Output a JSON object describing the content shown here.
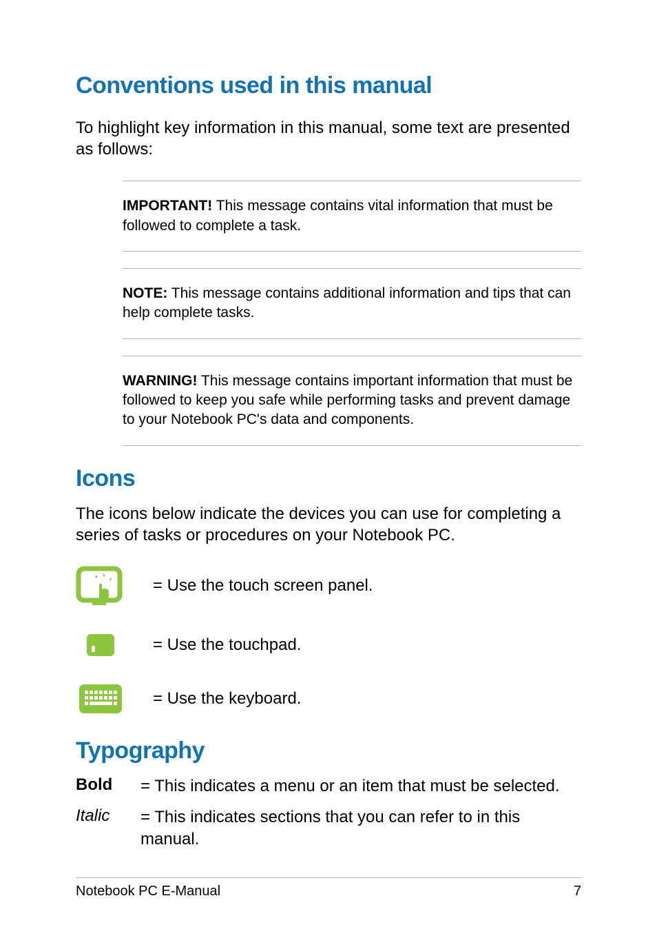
{
  "headings": {
    "conventions": "Conventions used in this manual",
    "icons": "Icons",
    "typography": "Typography"
  },
  "body": {
    "conventions_intro": "To highlight key information in this manual, some text are presented as follows:",
    "icons_intro": "The icons below indicate the devices you can use for completing a series of tasks or procedures on your Notebook PC."
  },
  "callouts": {
    "important": {
      "label": "IMPORTANT!",
      "text": " This message contains vital information that must be followed to complete a task."
    },
    "note": {
      "label": "NOTE:",
      "text": " This message contains additional information and tips that can help complete tasks."
    },
    "warning": {
      "label": "WARNING!",
      "text": " This message contains important information that must be followed to keep you safe while performing tasks and prevent damage to your Notebook PC's data and components."
    }
  },
  "icon_items": {
    "touchscreen": "= Use the touch screen panel.",
    "touchpad": "= Use the touchpad.",
    "keyboard": "= Use the keyboard."
  },
  "typography_items": {
    "bold_label": "Bold",
    "bold_desc": "= This indicates a menu or an item that must be selected.",
    "italic_label": "Italic",
    "italic_desc": "= This indicates sections that you can refer to in this manual."
  },
  "footer": {
    "title": "Notebook PC E-Manual",
    "page": "7"
  },
  "colors": {
    "heading": "#1073b5",
    "icon_green": "#8cc63f"
  }
}
